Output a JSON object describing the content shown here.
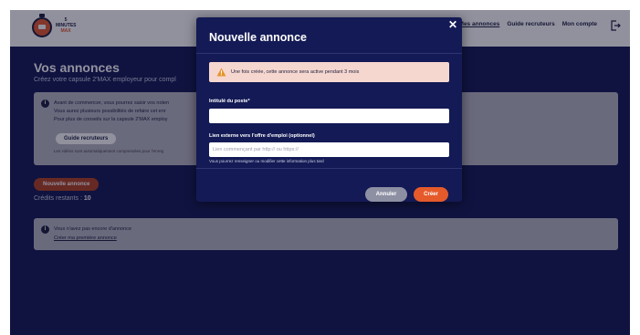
{
  "nav": {
    "logo_line1": "5",
    "logo_line2": "MINUTES",
    "logo_line3": "MAX",
    "items": [
      {
        "label": "Mes annonces"
      },
      {
        "label": "Guide recruteurs"
      },
      {
        "label": "Mon compte"
      }
    ],
    "logout_icon": "logout-icon"
  },
  "page": {
    "title": "Vos annonces",
    "subtitle": "Créez votre capsule 2'MAX employeur pour compl",
    "info_lines": [
      "Avant de commencer, vous pourrez saisir vos noten",
      "Vous aurez plusieurs possibilités de refaire cet enr",
      "Pour plus de conseils sur la capsule 2'MAX employ"
    ],
    "guide_button": "Guide recruteurs",
    "info_note": "Les vidéos sont automatiquement compressées pour l'enreg",
    "new_button": "Nouvelle annonce",
    "credits_label": "Crédits restants : ",
    "credits_value": "10",
    "empty_text": "Vous n'avez pas encore d'annonce",
    "empty_link": "Créer ma première annonce"
  },
  "modal": {
    "title": "Nouvelle annonce",
    "close_symbol": "✕",
    "alert_text": "Une fois créée, cette annonce sera active pendant 3 mois",
    "field1_label": "Intitulé du poste*",
    "field1_value": "",
    "field2_label": "Lien externe vers l'offre d'emploi (optionnel)",
    "field2_placeholder": "Lien commençant par http:// ou https://",
    "field2_hint": "Vous pourrez renseigner ou modifier cette information plus tard",
    "cancel_label": "Annuler",
    "create_label": "Créer"
  },
  "colors": {
    "background": "#141a55",
    "accent": "#e55a2b",
    "alert_bg": "#f6d7cf",
    "cancel": "#8d8fa3"
  }
}
